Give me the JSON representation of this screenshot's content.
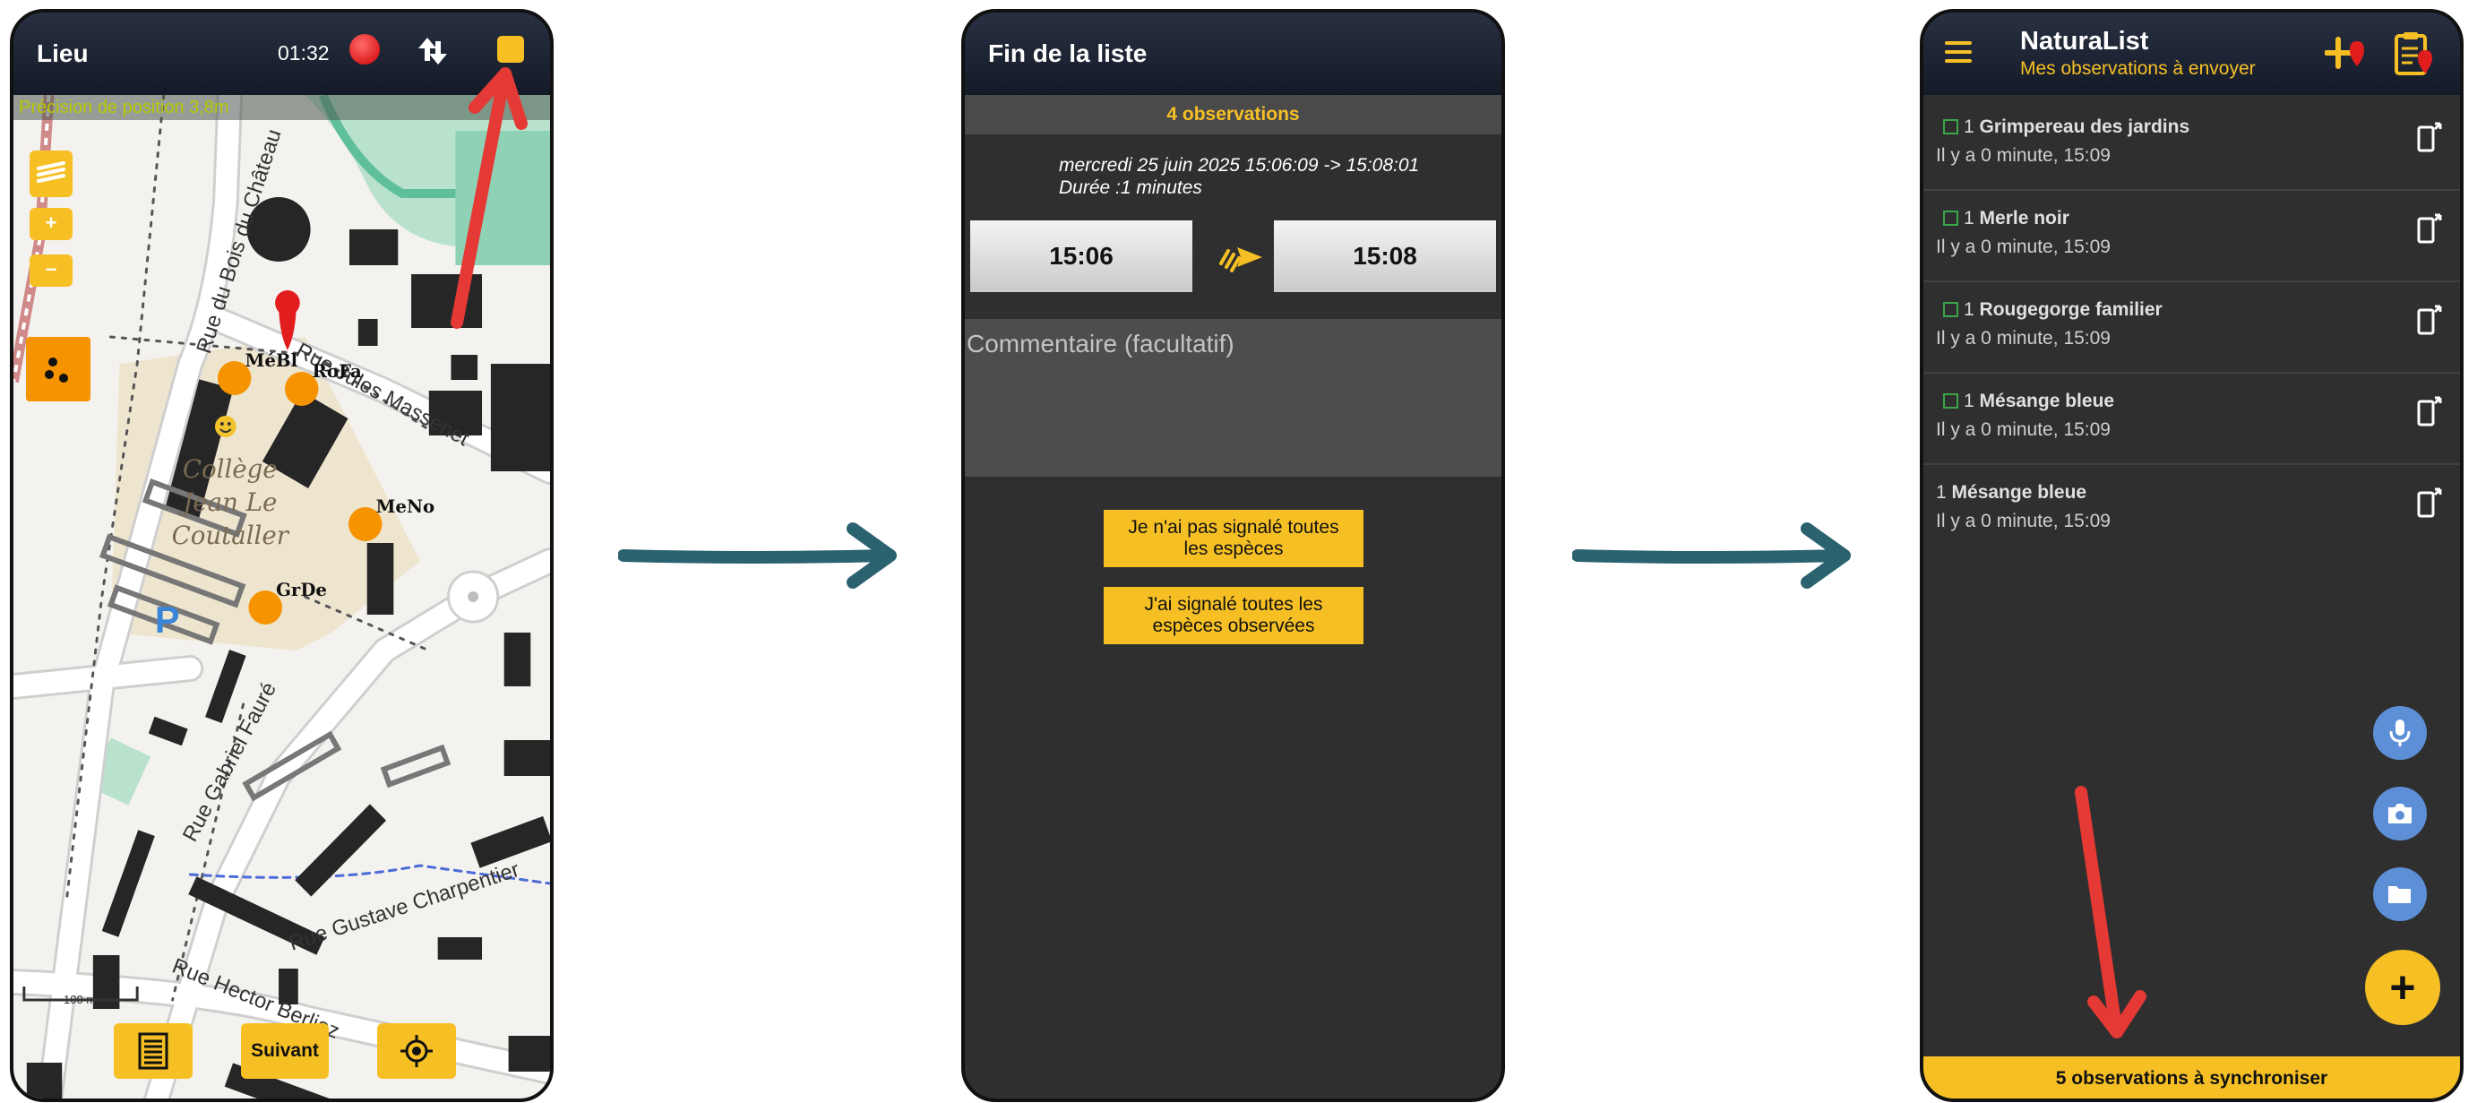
{
  "screen1": {
    "title": "Lieu",
    "clock": "01:32",
    "precision": "Précision de position 3,8m",
    "zoom_in": "+",
    "zoom_out": "−",
    "markers": [
      {
        "label": "MéBl"
      },
      {
        "label": "RoFa"
      },
      {
        "label": "MeNo"
      },
      {
        "label": "GrDe"
      }
    ],
    "map_labels": {
      "street1": "Rue du Bois du Château",
      "street2": "Rue Jules Massenet",
      "street3": "Rue Gabriel Fauré",
      "street4": "Rue Gustave Charpentier",
      "street5": "Rue Hector Berlioz",
      "building": [
        "Collège",
        "Jean Le",
        "Coutaller"
      ],
      "parking": "P",
      "scale": "100 m"
    },
    "next_label": "Suivant",
    "colors": {
      "accent": "#f6c025",
      "marker": "#f59300",
      "pin": "#e11d1d"
    }
  },
  "screen2": {
    "title": "Fin de la liste",
    "count": "4 observations",
    "date_range": "mercredi 25 juin 2025 15:06:09 -> 15:08:01",
    "duration": "Durée :1 minutes",
    "start_time": "15:06",
    "end_time": "15:08",
    "comment_placeholder": "Commentaire (facultatif)",
    "btn_not_all": [
      "Je n'ai pas signalé toutes",
      "les espèces"
    ],
    "btn_all": [
      "J'ai signalé toutes les",
      "espèces observées"
    ]
  },
  "screen3": {
    "app_title": "NaturaList",
    "subtitle": "Mes observations à envoyer",
    "observations": [
      {
        "count": "1",
        "species": "Grimpereau des jardins",
        "time": "Il y a 0 minute, 15:09",
        "checkbox": true
      },
      {
        "count": "1",
        "species": "Merle noir",
        "time": "Il y a 0 minute, 15:09",
        "checkbox": true
      },
      {
        "count": "1",
        "species": "Rougegorge familier",
        "time": "Il y a 0 minute, 15:09",
        "checkbox": true
      },
      {
        "count": "1",
        "species": "Mésange bleue",
        "time": "Il y a 0 minute, 15:09",
        "checkbox": true
      },
      {
        "count": "1",
        "species": "Mésange bleue",
        "time": "Il y a 0 minute, 15:09",
        "checkbox": false
      }
    ],
    "fab_add": "+",
    "sync_label": "5 observations à synchroniser",
    "icons": [
      "menu-icon",
      "add-marker-icon",
      "clipboard-icon",
      "phone-sync-icon",
      "microphone-icon",
      "camera-icon",
      "folder-icon"
    ]
  },
  "colors": {
    "flow_arrow": "#2a6270",
    "highlight_arrow": "#e53935",
    "dark_bg": "#2f2f2f"
  }
}
